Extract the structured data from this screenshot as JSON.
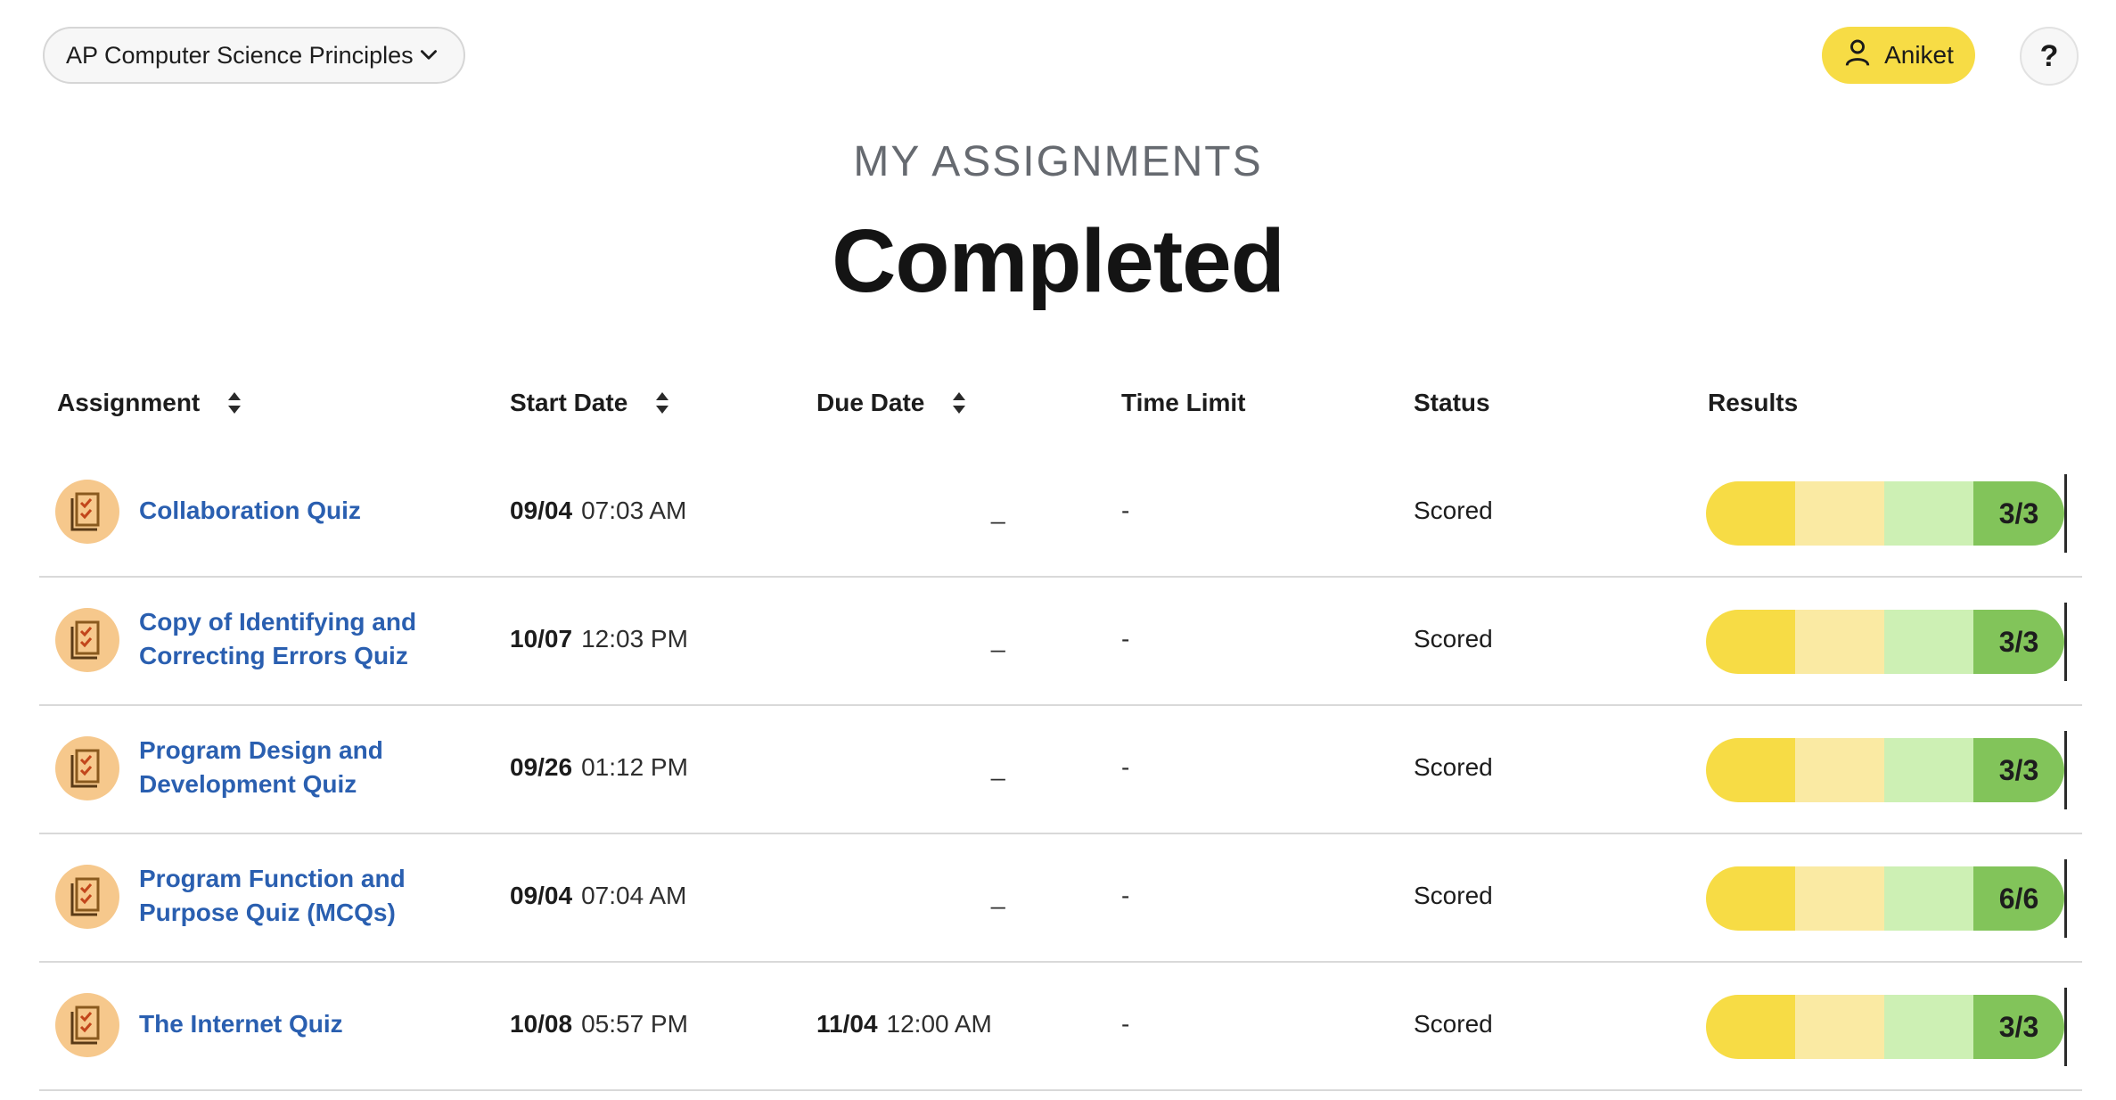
{
  "header": {
    "course": "AP Computer Science Principles",
    "user_name": "Aniket",
    "help_label": "?"
  },
  "page": {
    "eyebrow": "MY ASSIGNMENTS",
    "title": "Completed"
  },
  "table": {
    "columns": {
      "assignment": "Assignment",
      "start_date": "Start Date",
      "due_date": "Due Date",
      "time_limit": "Time Limit",
      "status": "Status",
      "results": "Results"
    },
    "rows": [
      {
        "name": "Collaboration Quiz",
        "start_day": "09/04",
        "start_time": "07:03 AM",
        "due_day": "",
        "due_time": "",
        "due_placeholder": "_",
        "time_limit": "-",
        "status": "Scored",
        "result": "3/3"
      },
      {
        "name": "Copy of Identifying and Correcting Errors Quiz",
        "start_day": "10/07",
        "start_time": "12:03 PM",
        "due_day": "",
        "due_time": "",
        "due_placeholder": "_",
        "time_limit": "-",
        "status": "Scored",
        "result": "3/3"
      },
      {
        "name": "Program Design and Development Quiz",
        "start_day": "09/26",
        "start_time": "01:12 PM",
        "due_day": "",
        "due_time": "",
        "due_placeholder": "_",
        "time_limit": "-",
        "status": "Scored",
        "result": "3/3"
      },
      {
        "name": "Program Function and Purpose Quiz (MCQs)",
        "start_day": "09/04",
        "start_time": "07:04 AM",
        "due_day": "",
        "due_time": "",
        "due_placeholder": "_",
        "time_limit": "-",
        "status": "Scored",
        "result": "6/6"
      },
      {
        "name": "The Internet Quiz",
        "start_day": "10/08",
        "start_time": "05:57 PM",
        "due_day": "11/04",
        "due_time": "12:00 AM",
        "due_placeholder": "",
        "time_limit": "-",
        "status": "Scored",
        "result": "3/3"
      }
    ]
  },
  "colors": {
    "accent_yellow": "#f7dc45",
    "link_blue": "#2a5fb0",
    "result_green": "#82c45a",
    "icon_bg": "#f6c88c"
  },
  "icons": {
    "course_dropdown": "chevron-down-icon",
    "user": "user-icon",
    "sort": "sort-icon",
    "assignment": "quiz-checklist-icon"
  }
}
